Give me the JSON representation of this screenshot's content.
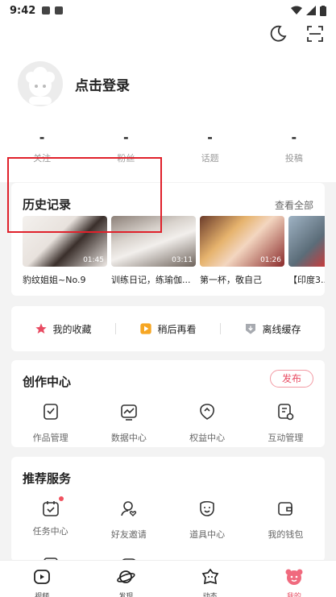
{
  "status_bar": {
    "time": "9:42"
  },
  "header": {
    "login_text": "点击登录",
    "stats": [
      {
        "value": "-",
        "label": "关注"
      },
      {
        "value": "-",
        "label": "粉丝"
      },
      {
        "value": "-",
        "label": "话题"
      },
      {
        "value": "-",
        "label": "投稿"
      }
    ]
  },
  "history": {
    "title": "历史记录",
    "see_all": "查看全部",
    "items": [
      {
        "caption": "豹纹姐姐~No.9",
        "duration": "01:45"
      },
      {
        "caption": "训练日记，练瑜伽...",
        "duration": "03:11"
      },
      {
        "caption": "第一杯，敬自己",
        "duration": "01:26"
      },
      {
        "caption": "【印度3...",
        "duration": ""
      }
    ]
  },
  "quick": {
    "favorites": "我的收藏",
    "watch_later": "稍后再看",
    "offline": "离线缓存"
  },
  "create_center": {
    "title": "创作中心",
    "publish": "发布",
    "items": [
      {
        "label": "作品管理",
        "icon": "works-icon"
      },
      {
        "label": "数据中心",
        "icon": "chart-icon"
      },
      {
        "label": "权益中心",
        "icon": "rights-icon"
      },
      {
        "label": "互动管理",
        "icon": "interaction-icon"
      }
    ]
  },
  "recommend": {
    "title": "推荐服务",
    "items": [
      {
        "label": "任务中心",
        "icon": "task-icon"
      },
      {
        "label": "好友邀请",
        "icon": "invite-icon"
      },
      {
        "label": "道具中心",
        "icon": "props-icon"
      },
      {
        "label": "我的钱包",
        "icon": "wallet-icon"
      }
    ]
  },
  "tabbar": [
    {
      "label": "视频",
      "icon": "video-icon"
    },
    {
      "label": "发现",
      "icon": "planet-icon"
    },
    {
      "label": "动态",
      "icon": "moments-icon"
    },
    {
      "label": "我的",
      "icon": "mine-icon",
      "active": true
    }
  ],
  "colors": {
    "accent": "#e84b62",
    "highlight_box": "#e0212b"
  }
}
